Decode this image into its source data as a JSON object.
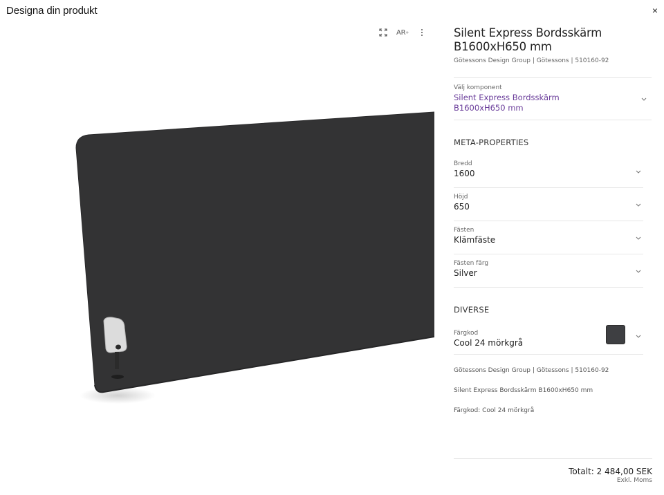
{
  "dialog": {
    "title": "Designa din produkt",
    "close_label": "×"
  },
  "viewer": {
    "toolbar": {
      "fullscreen_icon": "fullscreen-icon",
      "ar_label": "AR",
      "more_icon": "more-vertical-icon"
    },
    "product_colors": {
      "panel": "#333334",
      "edge": "#2a2a2b",
      "clamp": "#d9d9d9"
    }
  },
  "product": {
    "title": "Silent Express Bordsskärm B1600xH650 mm",
    "subtitle": "Götessons Design Group | Götessons | 510160-92"
  },
  "component": {
    "label": "Välj komponent",
    "value": "Silent Express Bordsskärm B1600xH650 mm",
    "accent": "#6a3d9a"
  },
  "meta": {
    "heading": "META-PROPERTIES",
    "props": [
      {
        "label": "Bredd",
        "value": "1600"
      },
      {
        "label": "Höjd",
        "value": "650"
      },
      {
        "label": "Fästen",
        "value": "Klämfäste"
      },
      {
        "label": "Fästen färg",
        "value": "Silver"
      }
    ]
  },
  "diverse": {
    "heading": "DIVERSE",
    "color": {
      "label": "Färgkod",
      "value": "Cool 24 mörkgrå",
      "swatch": "#3e3f42"
    }
  },
  "summary": {
    "lines": [
      "Götessons Design Group | Götessons | 510160-92",
      "Silent Express Bordsskärm B1600xH650 mm",
      "Färgkod: Cool 24 mörkgrå"
    ]
  },
  "footer": {
    "total": "Totalt: 2 484,00 SEK",
    "vat_note": "Exkl. Moms"
  }
}
